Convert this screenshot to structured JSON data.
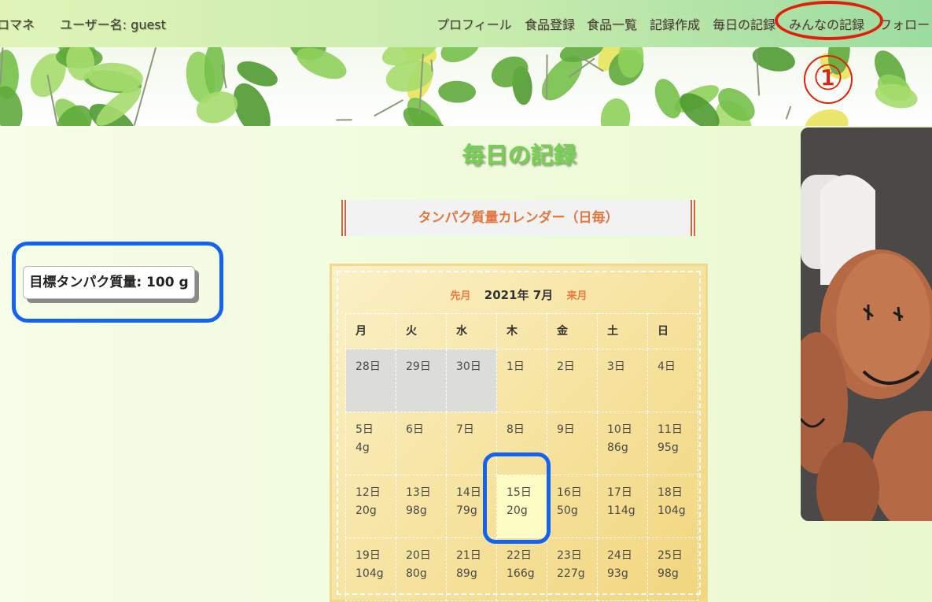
{
  "header": {
    "brand": "ロマネ",
    "user": "ユーザー名: guest",
    "nav": [
      "プロフィール",
      "食品登録",
      "食品一覧",
      "記録作成",
      "毎日の記録",
      "みんなの記録",
      "フォロー"
    ]
  },
  "annotation": {
    "circle_number": "①"
  },
  "page_title": "毎日の記録",
  "calendar_heading": "タンパク質量カレンダー（日毎）",
  "target": {
    "text": "目標タンパク質量: 100 g"
  },
  "calendar": {
    "prev": "先月",
    "current": "2021年 7月",
    "next": "来月",
    "weekdays": [
      "月",
      "火",
      "水",
      "木",
      "金",
      "土",
      "日"
    ],
    "weeks": [
      [
        {
          "day": "28日",
          "amount": "",
          "prev": true
        },
        {
          "day": "29日",
          "amount": "",
          "prev": true
        },
        {
          "day": "30日",
          "amount": "",
          "prev": true
        },
        {
          "day": "1日",
          "amount": ""
        },
        {
          "day": "2日",
          "amount": ""
        },
        {
          "day": "3日",
          "amount": ""
        },
        {
          "day": "4日",
          "amount": ""
        }
      ],
      [
        {
          "day": "5日",
          "amount": "4g"
        },
        {
          "day": "6日",
          "amount": ""
        },
        {
          "day": "7日",
          "amount": ""
        },
        {
          "day": "8日",
          "amount": ""
        },
        {
          "day": "9日",
          "amount": ""
        },
        {
          "day": "10日",
          "amount": "86g"
        },
        {
          "day": "11日",
          "amount": "95g"
        }
      ],
      [
        {
          "day": "12日",
          "amount": "20g"
        },
        {
          "day": "13日",
          "amount": "98g"
        },
        {
          "day": "14日",
          "amount": "79g"
        },
        {
          "day": "15日",
          "amount": "20g",
          "highlight": true
        },
        {
          "day": "16日",
          "amount": "50g"
        },
        {
          "day": "17日",
          "amount": "114g"
        },
        {
          "day": "18日",
          "amount": "104g"
        }
      ],
      [
        {
          "day": "19日",
          "amount": "104g"
        },
        {
          "day": "20日",
          "amount": "80g"
        },
        {
          "day": "21日",
          "amount": "89g"
        },
        {
          "day": "22日",
          "amount": "166g"
        },
        {
          "day": "23日",
          "amount": "227g"
        },
        {
          "day": "24日",
          "amount": "93g"
        },
        {
          "day": "25日",
          "amount": "98g"
        }
      ]
    ]
  }
}
